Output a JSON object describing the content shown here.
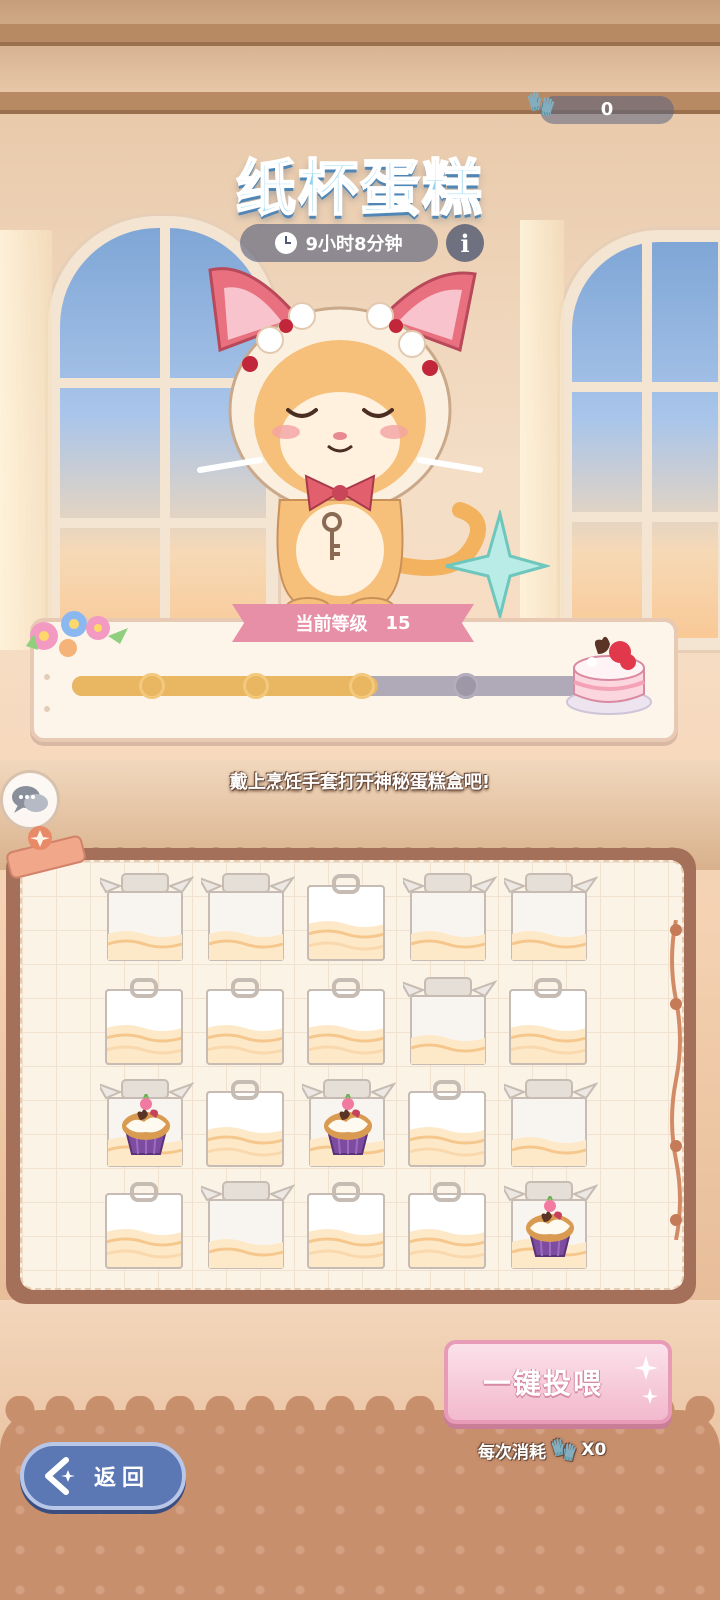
{
  "header": {
    "currency_value": "0",
    "currency_icon": "oven-mitt-icon",
    "title": "纸杯蛋糕",
    "timer": "9小时8分钟",
    "info_label": "i"
  },
  "level": {
    "label": "当前等级",
    "value": "15",
    "progress_nodes_reached": 3,
    "progress_nodes_total": 4,
    "progress_fraction": 0.6,
    "reward_icon": "strawberry-cake-icon"
  },
  "hint": "戴上烹饪手套打开神秘蛋糕盒吧!",
  "board": {
    "rows": [
      [
        "open",
        "open",
        "closed",
        "open",
        "open"
      ],
      [
        "closed",
        "closed",
        "closed",
        "open",
        "closed"
      ],
      [
        "cupcake",
        "closed",
        "cupcake",
        "closed",
        "open"
      ],
      [
        "closed",
        "open",
        "closed",
        "closed",
        "cupcake"
      ]
    ]
  },
  "feed_button": {
    "label": "一键投喂"
  },
  "cost": {
    "label": "每次消耗",
    "amount": "X0"
  },
  "back_button": {
    "label": "返回"
  },
  "colors": {
    "title_fill": "#8fd3f0",
    "ribbon": "#e78fa7",
    "progress_fill": "#e9b662",
    "progress_track": "#b0aab8",
    "feed_button": "#f2b9cd",
    "back_button": "#5c78b4"
  }
}
